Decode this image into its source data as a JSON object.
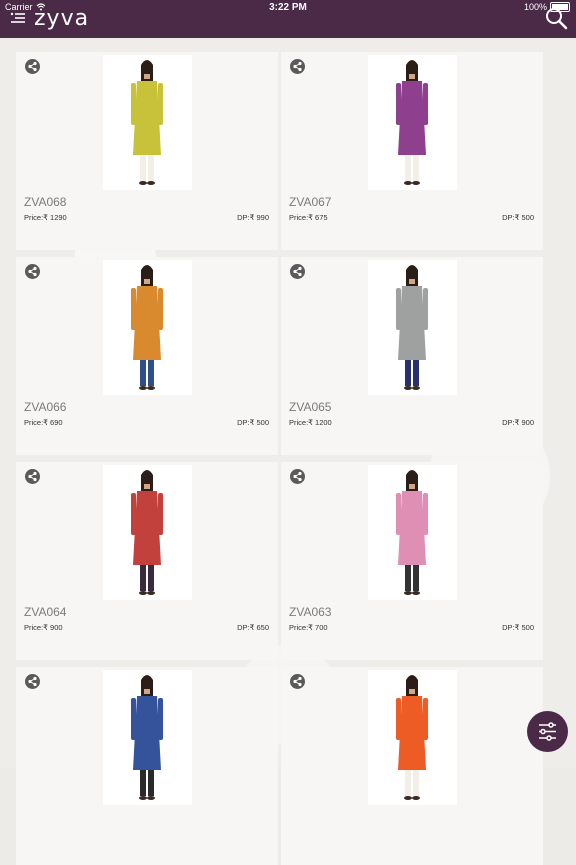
{
  "status": {
    "carrier": "Carrier",
    "time": "3:22 PM",
    "battery": "100%"
  },
  "header": {
    "logo": "zyva"
  },
  "products": [
    {
      "code": "ZVA068",
      "price": "Price:₹ 1290",
      "dp": "DP:₹ 990",
      "dress": "#c7c23a",
      "legs": "#f1efe6"
    },
    {
      "code": "ZVA067",
      "price": "Price:₹ 675",
      "dp": "DP:₹ 500",
      "dress": "#8e3f8d",
      "legs": "#f1efe6"
    },
    {
      "code": "ZVA066",
      "price": "Price:₹ 690",
      "dp": "DP:₹ 500",
      "dress": "#d98a2e",
      "legs": "#2f4f86"
    },
    {
      "code": "ZVA065",
      "price": "Price:₹ 1200",
      "dp": "DP:₹ 900",
      "dress": "#9fa1a1",
      "legs": "#28306e"
    },
    {
      "code": "ZVA064",
      "price": "Price:₹ 900",
      "dp": "DP:₹ 650",
      "dress": "#c3413c",
      "legs": "#3a2a3d"
    },
    {
      "code": "ZVA063",
      "price": "Price:₹ 700",
      "dp": "DP:₹ 500",
      "dress": "#df8fb4",
      "legs": "#333333"
    },
    {
      "code": "",
      "price": "",
      "dp": "",
      "dress": "#34539b",
      "legs": "#2a2a2a"
    },
    {
      "code": "",
      "price": "",
      "dp": "",
      "dress": "#ee5c26",
      "legs": "#f1efe6"
    }
  ],
  "colors": {
    "brand": "#4a2a47",
    "card": "#f7f6f4"
  }
}
